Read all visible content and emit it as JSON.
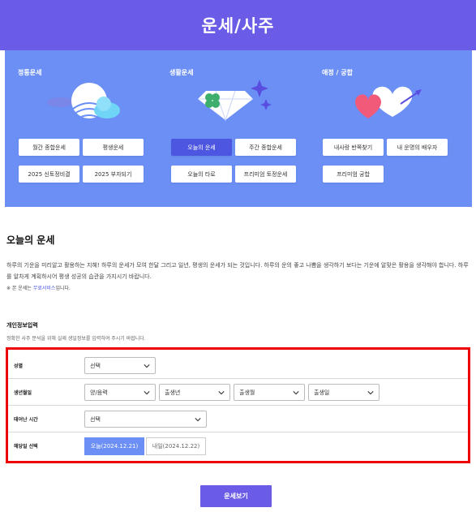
{
  "header": {
    "title": "운세/사주"
  },
  "banner": {
    "columns": [
      {
        "title": "정통운세",
        "buttons": [
          "월간 종합운세",
          "평생운세",
          "2025 신토정비결",
          "2025 부자되기"
        ]
      },
      {
        "title": "생활운세",
        "buttons": [
          "오늘의 운세",
          "주간 종합운세",
          "오늘의 타로",
          "프리미엄 토정운세"
        ]
      },
      {
        "title": "애정 / 궁합",
        "buttons": [
          "내사랑 반쪽찾기",
          "내 운명의 배우자",
          "프리미엄 궁합"
        ]
      }
    ],
    "active_button": "오늘의 운세"
  },
  "main": {
    "section_title": "오늘의 운세",
    "description": "하루의 기운을 미리알고 활용하는 지혜! 하루의 운세가 모여 한달 그리고 일년, 평생의 운세가 되는 것입니다. 하루의 운의 좋고 나쁨을 생각하기 보다는 기운에 알맞은 활용을 생각해야 합니다. 하루를 알차게 계획하시어 평생 성공의 습관을 가지시기 바랍니다.",
    "note_prefix": "※ 본 운세는 ",
    "note_link": "무료서비스",
    "note_suffix": "입니다."
  },
  "form": {
    "title": "개인정보입력",
    "description": "정확한 사주 분석을 위해 실제 생일정보를 입력하여 주시기 바랍니다.",
    "gender": {
      "label": "성별",
      "value": "선택"
    },
    "birth": {
      "label": "생년월일",
      "calendar": "양/음력",
      "year": "출생년",
      "month": "출생월",
      "day": "출생일"
    },
    "time": {
      "label": "태어난 시간",
      "value": "선택"
    },
    "date": {
      "label": "해당일 선택",
      "today": "오늘(2024.12.21)",
      "tomorrow": "내일(2024.12.22)"
    }
  },
  "submit_label": "운세보기",
  "colors": {
    "header": "#6b5ce7",
    "banner": "#6b8ff5",
    "active": "#4c56e0",
    "highlight_border": "#ee0000"
  }
}
